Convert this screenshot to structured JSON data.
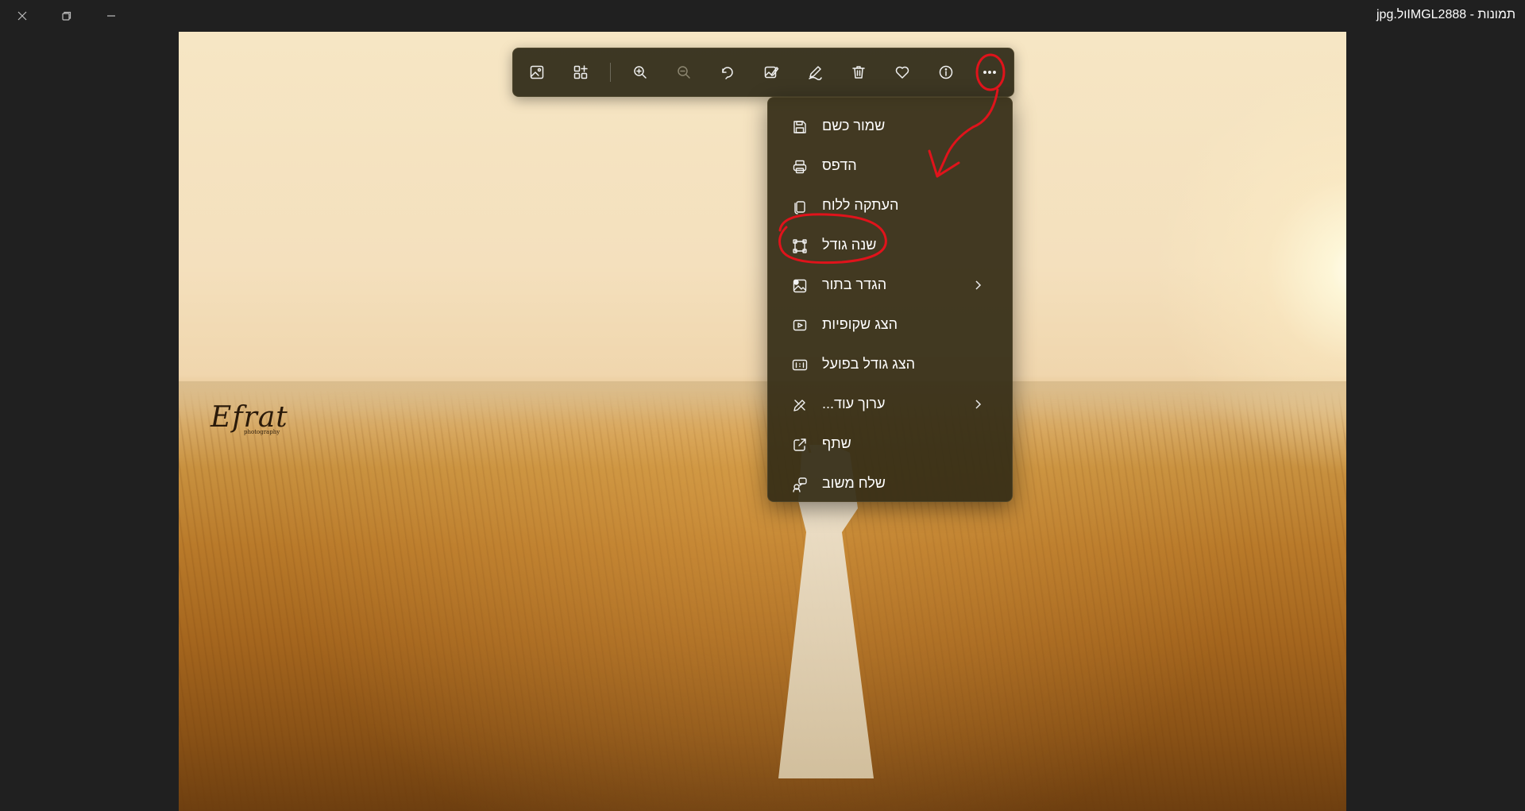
{
  "window": {
    "title": "תמונות - IMGL2888ול.jpg",
    "close_icon": "close-icon",
    "restore_icon": "restore-icon",
    "minimize_icon": "minimize-icon"
  },
  "photo": {
    "watermark": "Efrat",
    "watermark_sub": "photography"
  },
  "toolbar": {
    "buttons": [
      {
        "icon": "edit-image-icon"
      },
      {
        "icon": "add-to-album-icon"
      },
      {
        "icon": "zoom-in-icon"
      },
      {
        "icon": "zoom-out-icon",
        "disabled": true
      },
      {
        "icon": "rotate-icon"
      },
      {
        "icon": "edit-photo-icon"
      },
      {
        "icon": "draw-icon"
      },
      {
        "icon": "delete-icon"
      },
      {
        "icon": "favorite-icon"
      },
      {
        "icon": "info-icon"
      },
      {
        "icon": "more-options-icon"
      }
    ]
  },
  "menu": {
    "items": [
      {
        "label": "שמור כשם",
        "icon": "save-icon"
      },
      {
        "label": "הדפס",
        "icon": "print-icon"
      },
      {
        "label": "העתקה ללוח",
        "icon": "copy-icon"
      },
      {
        "label": "שנה גודל",
        "icon": "resize-icon"
      },
      {
        "label": "הגדר בתור",
        "icon": "set-as-icon",
        "submenu": true
      },
      {
        "label": "הצג שקופיות",
        "icon": "slideshow-icon"
      },
      {
        "label": "הצג גודל בפועל",
        "icon": "actual-size-icon"
      },
      {
        "label": "ערוך עוד...",
        "icon": "edit-more-icon",
        "submenu": true
      },
      {
        "label": "שתף",
        "icon": "share-icon"
      },
      {
        "label": "שלח משוב",
        "icon": "feedback-icon"
      }
    ]
  },
  "colors": {
    "annotation": "#e0131b",
    "titlebar_bg": "#202020",
    "menu_bg": "#342c16"
  }
}
